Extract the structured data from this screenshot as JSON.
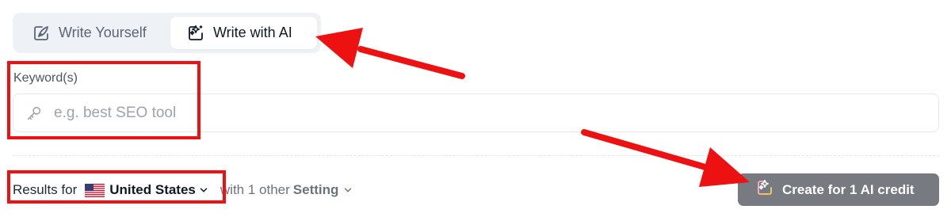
{
  "tabs": [
    {
      "label": "Write Yourself",
      "icon": "pen-icon",
      "active": false
    },
    {
      "label": "Write with AI",
      "icon": "ai-sparkle-icon",
      "active": true
    }
  ],
  "keyword": {
    "label": "Keyword(s)",
    "placeholder": "e.g. best SEO tool",
    "value": "",
    "icon": "key-icon"
  },
  "results": {
    "prefix": "Results for",
    "country": "United States",
    "flag_icon": "us-flag-icon",
    "other_text": "with 1 other",
    "setting_label": "Setting"
  },
  "create_button": {
    "label": "Create for 1 AI credit",
    "icon": "ai-sparkle-icon",
    "color": "#777a80"
  },
  "annotation_color": "#ee1111"
}
